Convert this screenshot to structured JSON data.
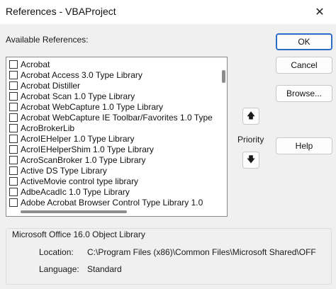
{
  "window": {
    "title": "References - VBAProject",
    "close_glyph": "✕"
  },
  "available_label": "Available References:",
  "references": [
    {
      "label": "Acrobat",
      "checked": false
    },
    {
      "label": "Acrobat Access 3.0 Type Library",
      "checked": false
    },
    {
      "label": "Acrobat Distiller",
      "checked": false
    },
    {
      "label": "Acrobat Scan 1.0 Type Library",
      "checked": false
    },
    {
      "label": "Acrobat WebCapture 1.0 Type Library",
      "checked": false
    },
    {
      "label": "Acrobat WebCapture IE Toolbar/Favorites 1.0 Type",
      "checked": false
    },
    {
      "label": "AcroBrokerLib",
      "checked": false
    },
    {
      "label": "AcroIEHelper 1.0 Type Library",
      "checked": false
    },
    {
      "label": "AcroIEHelperShim 1.0 Type Library",
      "checked": false
    },
    {
      "label": "AcroScanBroker 1.0 Type Library",
      "checked": false
    },
    {
      "label": "Active DS Type Library",
      "checked": false
    },
    {
      "label": "ActiveMovie control type library",
      "checked": false
    },
    {
      "label": "AdbeAcadIc 1.0 Type Library",
      "checked": false
    },
    {
      "label": "Adobe Acrobat Browser Control Type Library 1.0",
      "checked": false
    }
  ],
  "buttons": {
    "ok": "OK",
    "cancel": "Cancel",
    "browse": "Browse...",
    "help": "Help"
  },
  "priority": {
    "label": "Priority",
    "up_glyph": "🡅",
    "down_glyph": "🡇"
  },
  "selection": {
    "group_title": "Microsoft Office 16.0 Object Library",
    "location_label": "Location:",
    "location_value": "C:\\Program Files (x86)\\Common Files\\Microsoft Shared\\OFF",
    "language_label": "Language:",
    "language_value": "Standard"
  },
  "colors": {
    "default_button_border": "#2d6cc9",
    "dialog_background": "#f0f0f0"
  }
}
